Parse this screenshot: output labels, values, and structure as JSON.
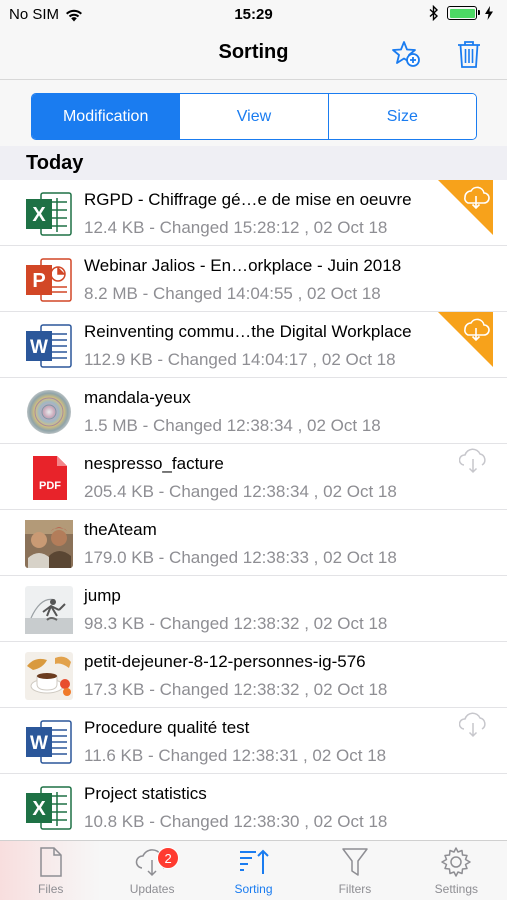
{
  "status": {
    "carrier": "No SIM",
    "time": "15:29"
  },
  "nav": {
    "title": "Sorting",
    "favorite_icon": "star-add-icon",
    "trash_icon": "trash-icon"
  },
  "segments": [
    {
      "label": "Modification",
      "active": true
    },
    {
      "label": "View",
      "active": false
    },
    {
      "label": "Size",
      "active": false
    }
  ],
  "section": {
    "title": "Today"
  },
  "files": [
    {
      "name": "RGPD - Chiffrage gé…e de mise en oeuvre",
      "meta": "12.4 KB - Changed 15:28:12 , 02 Oct 18",
      "type": "excel",
      "cloud": "orange"
    },
    {
      "name": "Webinar Jalios - En…orkplace - Juin 2018",
      "meta": "8.2 MB - Changed 14:04:55 , 02 Oct 18",
      "type": "powerpoint",
      "cloud": "none"
    },
    {
      "name": "Reinventing commu…the Digital Workplace",
      "meta": "112.9 KB - Changed 14:04:17 , 02 Oct 18",
      "type": "word",
      "cloud": "orange"
    },
    {
      "name": "mandala-yeux",
      "meta": "1.5 MB - Changed 12:38:34 , 02 Oct 18",
      "type": "image-mandala",
      "cloud": "none"
    },
    {
      "name": "nespresso_facture",
      "meta": "205.4 KB - Changed 12:38:34 , 02 Oct 18",
      "type": "pdf",
      "cloud": "gray"
    },
    {
      "name": "theAteam",
      "meta": "179.0 KB - Changed 12:38:33 , 02 Oct 18",
      "type": "image-team",
      "cloud": "none"
    },
    {
      "name": "jump",
      "meta": "98.3 KB - Changed 12:38:32 , 02 Oct 18",
      "type": "image-jump",
      "cloud": "none"
    },
    {
      "name": "petit-dejeuner-8-12-personnes-ig-576",
      "meta": "17.3 KB - Changed 12:38:32 , 02 Oct 18",
      "type": "image-breakfast",
      "cloud": "none"
    },
    {
      "name": "Procedure qualité test",
      "meta": "11.6 KB - Changed 12:38:31 , 02 Oct 18",
      "type": "word",
      "cloud": "gray"
    },
    {
      "name": "Project statistics",
      "meta": "10.8 KB - Changed 12:38:30 , 02 Oct 18",
      "type": "excel",
      "cloud": "none"
    }
  ],
  "tabs": [
    {
      "label": "Files",
      "icon": "file-icon",
      "badge": ""
    },
    {
      "label": "Updates",
      "icon": "cloud-download-icon",
      "badge": "2"
    },
    {
      "label": "Sorting",
      "icon": "sort-icon",
      "badge": ""
    },
    {
      "label": "Filters",
      "icon": "filter-icon",
      "badge": ""
    },
    {
      "label": "Settings",
      "icon": "gear-icon",
      "badge": ""
    }
  ],
  "colors": {
    "accent": "#1a7cf0",
    "excel": "#1e7145",
    "powerpoint": "#d24726",
    "word": "#2b579a",
    "pdf": "#e8232a",
    "cloud_badge": "#f7a21b",
    "badge": "#ff3b30"
  }
}
